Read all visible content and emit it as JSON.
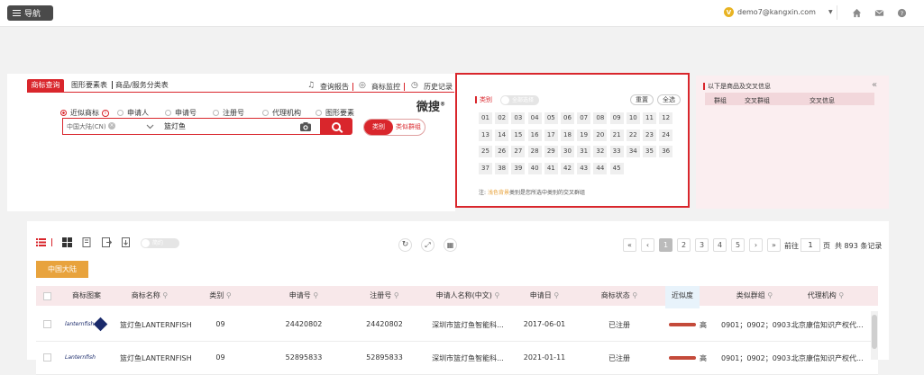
{
  "topbar": {
    "nav_label": "导航",
    "user_badge": "V",
    "user_email": "demo7@kangxin.com",
    "caret": "▼",
    "icons": [
      "home-icon",
      "mail-icon",
      "help-icon"
    ]
  },
  "search": {
    "tabs": [
      "商标查询",
      "图形要素表",
      "商品/服务分类表"
    ],
    "links": [
      "查询报告",
      "商标监控",
      "历史记录"
    ],
    "radios": [
      "近似商标",
      "申请人",
      "申请号",
      "注册号",
      "代理机构",
      "图形要素"
    ],
    "country": "中国大陆(CN)",
    "query": "篮灯鱼",
    "toggle_on": "类别",
    "toggle_off": "类似群组",
    "weisou": "微搜",
    "weisou_mark": "®"
  },
  "classes": {
    "label": "类别",
    "switch_label": "全部选择",
    "reset": "重置",
    "select_all": "全选",
    "numbers": [
      "01",
      "02",
      "03",
      "04",
      "05",
      "06",
      "07",
      "08",
      "09",
      "10",
      "11",
      "12",
      "13",
      "14",
      "15",
      "16",
      "17",
      "18",
      "19",
      "20",
      "21",
      "22",
      "23",
      "24",
      "25",
      "26",
      "27",
      "28",
      "29",
      "30",
      "31",
      "32",
      "33",
      "34",
      "35",
      "36",
      "37",
      "38",
      "39",
      "40",
      "41",
      "42",
      "43",
      "44",
      "45"
    ],
    "note_prefix": "注:",
    "note_hl": "浅色背景",
    "note_rest": "类别是您所选中类别的交叉群组"
  },
  "cross": {
    "title": "以下是商品及交叉信息",
    "collapse": "«",
    "headers": [
      "群组",
      "交叉群组",
      "交叉信息"
    ]
  },
  "results": {
    "switch_label": "简约",
    "region_btn": "中国大陆",
    "pages": [
      "«",
      "‹",
      "1",
      "2",
      "3",
      "4",
      "5",
      "›",
      "»"
    ],
    "goto_label": "前往",
    "goto_value": "1",
    "page_unit": "页",
    "total": "共 893 条记录",
    "headers": [
      "商标图案",
      "商标名称",
      "类别",
      "申请号",
      "注册号",
      "申请人名称(中文)",
      "申请日",
      "商标状态",
      "近似度",
      "类似群组",
      "代理机构"
    ],
    "rows": [
      {
        "logo": "lanternfish",
        "name": "篮灯鱼LANTERNFISH",
        "cls": "09",
        "app_no": "24420802",
        "reg_no": "24420802",
        "applicant": "深圳市篮灯鱼智能科...",
        "date": "2017-06-01",
        "status": "已注册",
        "sim": "高",
        "groups": "0901；0902；0903...",
        "agent": "北京康信知识产权代..."
      },
      {
        "logo": "Lanternfish",
        "name": "篮灯鱼LANTERNFISH",
        "cls": "09",
        "app_no": "52895833",
        "reg_no": "52895833",
        "applicant": "深圳市篮灯鱼智能科...",
        "date": "2021-01-11",
        "status": "已注册",
        "sim": "高",
        "groups": "0901；0902；0903...",
        "agent": "北京康信知识产权代..."
      }
    ]
  }
}
